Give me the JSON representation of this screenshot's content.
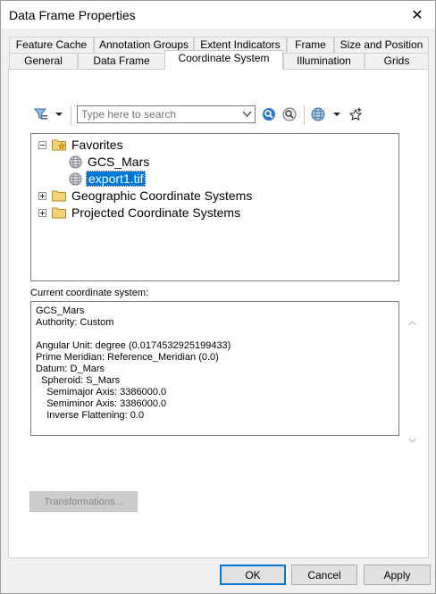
{
  "window": {
    "title": "Data Frame Properties",
    "close_glyph": "✕"
  },
  "tabs_row1": [
    {
      "label": "Feature Cache"
    },
    {
      "label": "Annotation Groups"
    },
    {
      "label": "Extent Indicators"
    },
    {
      "label": "Frame"
    },
    {
      "label": "Size and Position"
    }
  ],
  "tabs_row2": [
    {
      "label": "General"
    },
    {
      "label": "Data Frame"
    },
    {
      "label": "Coordinate System",
      "active": true
    },
    {
      "label": "Illumination"
    },
    {
      "label": "Grids"
    }
  ],
  "toolbar": {
    "search_placeholder": "Type here to search",
    "icons": [
      "filter-icon",
      "search-icon",
      "clear-search-icon",
      "globe-icon",
      "add-favorite-icon"
    ]
  },
  "tree": {
    "items": [
      {
        "label": "Favorites",
        "icon": "favorites-folder-icon",
        "expanded": true
      },
      {
        "label": "GCS_Mars",
        "icon": "globe-icon"
      },
      {
        "label": "export1.tif",
        "icon": "globe-icon",
        "selected": true
      },
      {
        "label": "Geographic Coordinate Systems",
        "icon": "folder-icon",
        "expanded": false
      },
      {
        "label": "Projected Coordinate Systems",
        "icon": "folder-icon",
        "expanded": false
      }
    ]
  },
  "current_cs": {
    "label": "Current coordinate system:",
    "lines": [
      "GCS_Mars",
      "Authority: Custom",
      "",
      "Angular Unit: degree (0.0174532925199433)",
      "Prime Meridian: Reference_Meridian (0.0)",
      "Datum: D_Mars",
      "  Spheroid: S_Mars",
      "    Semimajor Axis: 3386000.0",
      "    Semiminor Axis: 3386000.0",
      "    Inverse Flattening: 0.0"
    ]
  },
  "buttons": {
    "transformations": "Transformations...",
    "ok": "OK",
    "cancel": "Cancel",
    "apply": "Apply"
  },
  "colors": {
    "selection": "#0078d7",
    "dialog_bg": "#f0f0f0"
  }
}
